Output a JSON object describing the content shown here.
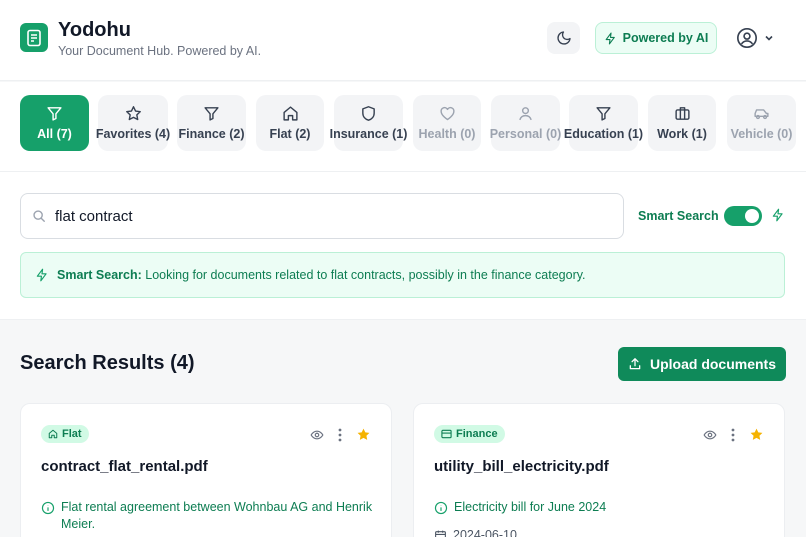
{
  "app": {
    "title": "Yodohu",
    "subtitle": "Your Document Hub. Powered by AI."
  },
  "header": {
    "powered_label": "Powered by AI"
  },
  "categories": [
    {
      "label": "All (7)",
      "icon": "filter-icon",
      "active": true
    },
    {
      "label": "Favorites (4)",
      "icon": "star-icon"
    },
    {
      "label": "Finance (2)",
      "icon": "filter-icon"
    },
    {
      "label": "Flat (2)",
      "icon": "home-icon"
    },
    {
      "label": "Insurance (1)",
      "icon": "shield-icon"
    },
    {
      "label": "Health (0)",
      "icon": "heart-icon",
      "muted": true
    },
    {
      "label": "Personal (0)",
      "icon": "person-icon",
      "muted": true
    },
    {
      "label": "Education (1)",
      "icon": "filter-icon"
    },
    {
      "label": "Work (1)",
      "icon": "briefcase-icon"
    },
    {
      "label": "Vehicle (0)",
      "icon": "car-icon",
      "muted": true
    }
  ],
  "search": {
    "value": "flat contract",
    "smart_label": "Smart Search",
    "smart_enabled": true
  },
  "smart_banner": {
    "prefix": "Smart Search:",
    "text": " Looking for documents related to flat contracts, possibly in the finance category."
  },
  "results": {
    "title": "Search Results (4)",
    "upload_label": "Upload documents"
  },
  "cards": [
    {
      "category": "Flat",
      "category_icon": "home-icon",
      "filename": "contract_flat_rental.pdf",
      "description": "Flat rental agreement between Wohnbau AG and Henrik Meier.",
      "date": "",
      "favorite": true
    },
    {
      "category": "Finance",
      "category_icon": "card-icon",
      "filename": "utility_bill_electricity.pdf",
      "description": "Electricity bill for June 2024",
      "date": "2024-06-10",
      "favorite": true
    }
  ],
  "colors": {
    "accent": "#16a06a",
    "accent_dark": "#0f8a5a",
    "accent_text": "#0d7d52",
    "star": "#f5b301"
  }
}
